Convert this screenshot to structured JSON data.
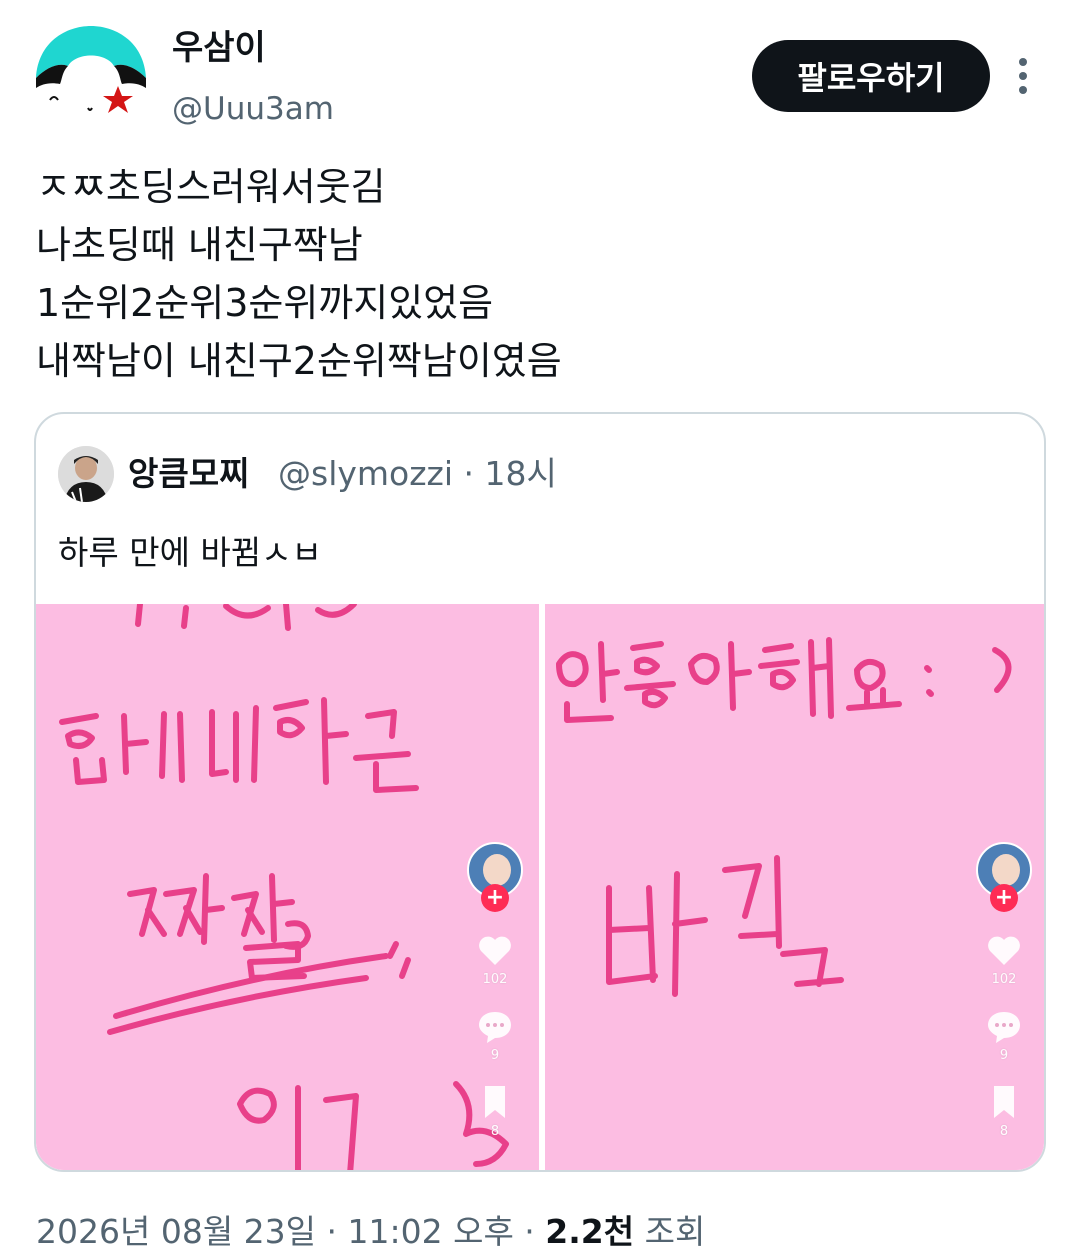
{
  "author": {
    "display_name": "우삼이",
    "handle": "@Uuu3am"
  },
  "follow_button": {
    "label": "팔로우하기"
  },
  "tweet": {
    "lines": [
      "ㅈㅉ초딩스러워서웃김",
      "나초딩때 내친구짝남",
      "1순위2순위3순위까지있었음",
      "내짝남이 내친구2순위짝남이였음"
    ]
  },
  "quote": {
    "display_name": "앙큼모찌",
    "handle_time": "@slymozzi · 18시",
    "text": "하루 만에 바뀜ㅅㅂ",
    "images": [
      {
        "handwriting": [
          "함께하는",
          "짝사랑"
        ],
        "likes": "102",
        "comments": "9",
        "saves": "8"
      },
      {
        "handwriting": [
          "안좋아해요 :)",
          "바뀜"
        ],
        "likes": "102",
        "comments": "9",
        "saves": "8"
      }
    ]
  },
  "footer": {
    "date_time": "2026년 08월 23일 · 11:02 오후 · ",
    "views_count": "2.2천",
    "views_label": " 조회"
  },
  "colors": {
    "text": "#0f1419",
    "muted": "#536471",
    "pink_bg": "#fcbde2",
    "ink": "#e8408a",
    "avatar_cyan": "#1fd6d0"
  }
}
